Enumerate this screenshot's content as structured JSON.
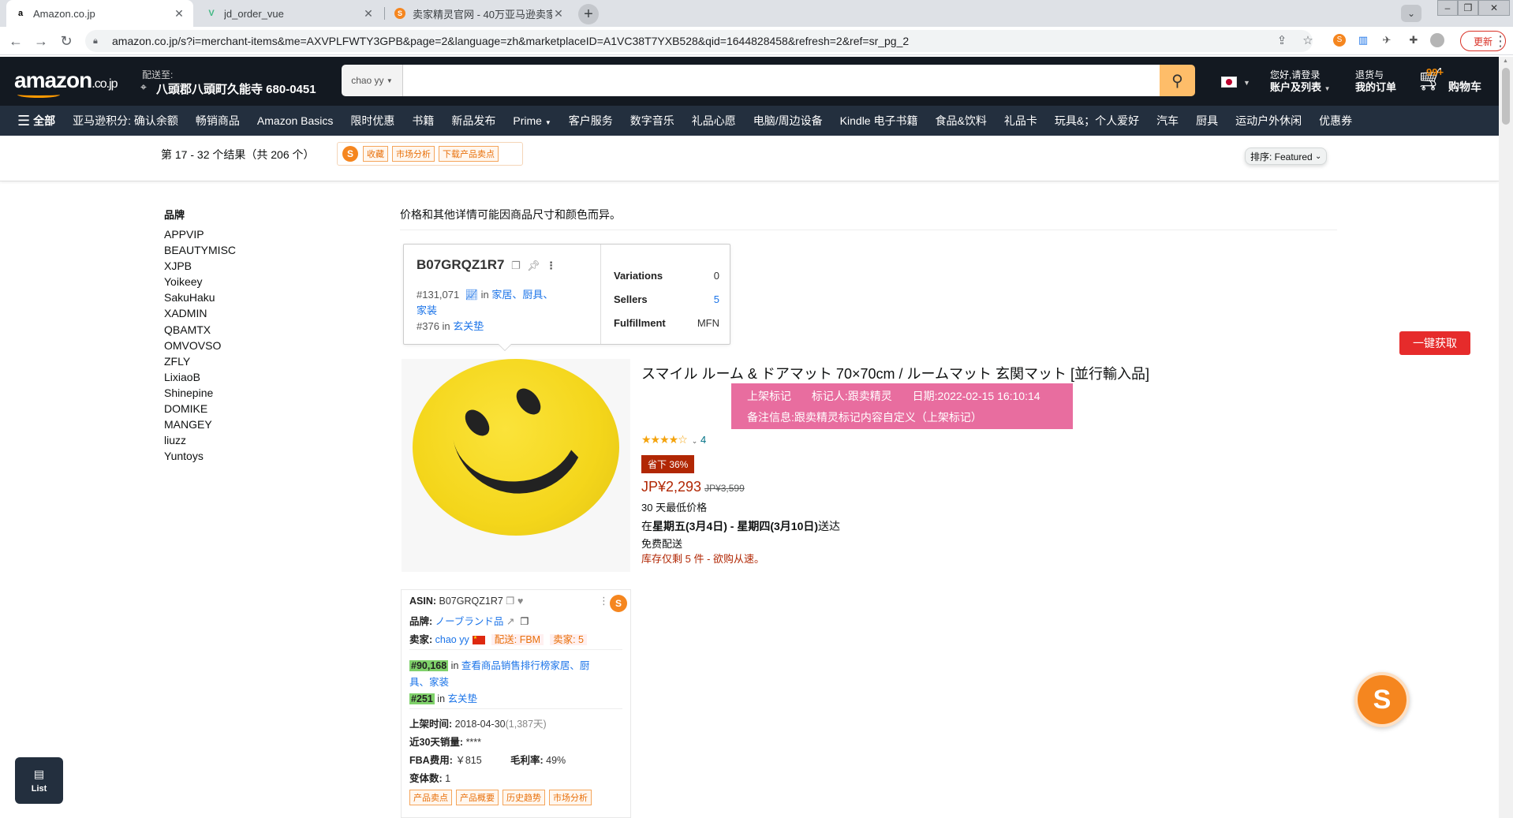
{
  "browser": {
    "tabs": [
      {
        "title": "Amazon.co.jp",
        "favicon": "amazon-a-icon"
      },
      {
        "title": "jd_order_vue",
        "favicon": "vue-icon"
      },
      {
        "title": "卖家精灵官网 - 40万亚马逊卖家",
        "favicon": "sellersprite-icon"
      }
    ],
    "url": "amazon.co.jp/s?i=merchant-items&me=AXVPLFWTY3GPB&page=2&language=zh&marketplaceID=A1VC38T7YXB528&qid=1644828458&refresh=2&ref=sr_pg_2",
    "update_label": "更新"
  },
  "header": {
    "logo": "amazon",
    "logo_suffix": ".co.jp",
    "deliver_line1": "配送至:",
    "deliver_line2": "八頭郡八頭町久能寺 680-0451",
    "search_category": "chao yy",
    "search_value": "",
    "account_line1": "您好,请登录",
    "account_line2": "账户及列表",
    "orders_line1": "退货与",
    "orders_line2": "我的订单",
    "cart_count": "99+",
    "cart_label": "购物车"
  },
  "nav": {
    "all_label": "全部",
    "items": [
      "亚马逊积分: 确认余额",
      "畅销商品",
      "Amazon Basics",
      "限时优惠",
      "书籍",
      "新品发布",
      "Prime",
      "客户服务",
      "数字音乐",
      "礼品心愿",
      "电脑/周边设备",
      "Kindle 电子书籍",
      "食品&饮料",
      "礼品卡",
      "玩具&；个人爱好",
      "汽车",
      "厨具",
      "运动户外休闲",
      "优惠券"
    ]
  },
  "results": {
    "count_text": "第 17 - 32 个结果（共 206 个）",
    "tool_tags": [
      "收藏",
      "市场分析",
      "下载产品卖点"
    ],
    "sort_label": "排序: Featured"
  },
  "filters": {
    "heading": "品牌",
    "brands": [
      "APPVIP",
      "BEAUTYMISC",
      "XJPB",
      "Yoikeey",
      "SakuHaku",
      "XADMIN",
      "QBAMTX",
      "OMVOVSO",
      "ZFLY",
      "LixiaoB",
      "Shinepine",
      "DOMIKE",
      "MANGEY",
      "liuzz",
      "Yuntoys"
    ]
  },
  "main": {
    "note": "价格和其他详情可能因商品尺寸和颜色而异。"
  },
  "asin_card": {
    "asin": "B07GRQZ1R7",
    "rank1_num": "#131,071",
    "rank1_in": "in",
    "rank1_cat_a": "家居、厨具、",
    "rank1_cat_b": "家装",
    "rank2_num": "#376",
    "rank2_in": "in",
    "rank2_cat": "玄关垫",
    "variations_label": "Variations",
    "variations_value": "0",
    "sellers_label": "Sellers",
    "sellers_value": "5",
    "fulfillment_label": "Fulfillment",
    "fulfillment_value": "MFN"
  },
  "product": {
    "title": "スマイル ルーム & ドアマット 70×70cm / ルームマット 玄関マット [並行輸入品]",
    "mark_tag": "上架标记",
    "marker": "标记人:跟卖精灵",
    "date": "日期:2022-02-15 16:10:14",
    "remark": "备注信息:跟卖精灵标记内容自定义（上架标记）",
    "rating_stars": "★★★★☆",
    "rating": 4,
    "rating_count": "4",
    "save_label": "省下 36%",
    "price": "JP¥2,293",
    "old_price": "JP¥3,599",
    "low30": "30 天最低价格",
    "delivery_prefix": "在",
    "delivery_dates": "星期五(3月4日) - 星期四(3月10日)",
    "delivery_suffix": "送达",
    "free_ship": "免费配送",
    "stock": "库存仅剩 5 件 - 欲购从速。"
  },
  "onekey_label": "一键获取",
  "seller_panel": {
    "asin_label": "ASIN:",
    "asin": "B07GRQZ1R7",
    "brand_label": "品牌:",
    "brand": "ノーブランド品",
    "seller_label": "卖家:",
    "seller": "chao yy",
    "ship_tag": "配送: FBM",
    "sellers_tag": "卖家: 5",
    "rank1": "#90,168",
    "rank1_in": "in",
    "rank1_cat_a": "查看商品销售排行榜家居、厨",
    "rank1_cat_b": "具、家装",
    "rank2": "#251",
    "rank2_in": "in",
    "rank2_cat": "玄关垫",
    "listed_label": "上架时间:",
    "listed": "2018-04-30",
    "listed_days": "(1,387天)",
    "sales_label": "近30天销量:",
    "sales": "****",
    "fba_label": "FBA费用:",
    "fba": "￥815",
    "margin_label": "毛利率:",
    "margin": "49%",
    "variants_label": "变体数:",
    "variants": "1",
    "buttons": [
      "产品卖点",
      "产品概要",
      "历史趋势",
      "市场分析"
    ]
  },
  "list_button": "List",
  "colors": {
    "amazon_dark": "#131921",
    "amazon_nav": "#232f3e",
    "amazon_orange": "#ff9900",
    "search_btn": "#febd69",
    "price_red": "#b12704",
    "pink_mark": "#e86d9f",
    "sellersprite_orange": "#f5861f"
  }
}
